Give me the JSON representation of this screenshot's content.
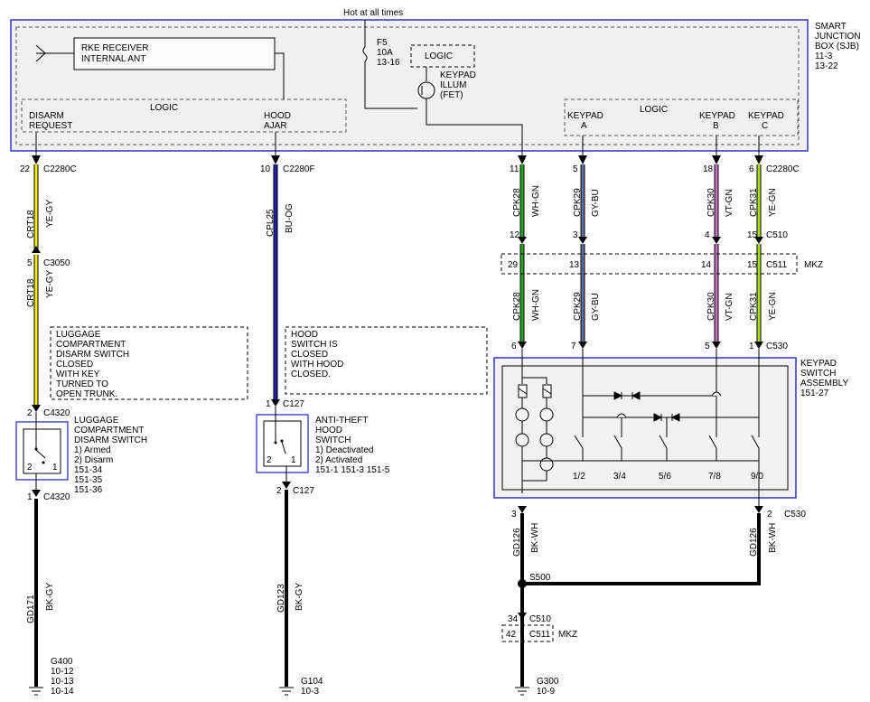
{
  "header": {
    "hot": "Hot at all times"
  },
  "sjb": {
    "name": [
      "SMART",
      "JUNCTION",
      "BOX (SJB)",
      "11-3",
      "13-22"
    ],
    "rke": [
      "RKE RECEIVER",
      "INTERNAL ANT"
    ],
    "fuse": [
      "F5",
      "10A",
      "13-16"
    ],
    "logic_small": "LOGIC",
    "keypad_illum": [
      "KEYPAD",
      "ILLUM",
      "(FET)"
    ],
    "logic_left": "LOGIC",
    "logic_right": "LOGIC",
    "disarm": [
      "DISARM",
      "REQUEST"
    ],
    "hood_ajar": [
      "HOOD",
      "AJAR"
    ],
    "keypad_a": [
      "KEYPAD",
      "A"
    ],
    "keypad_b": [
      "KEYPAD",
      "B"
    ],
    "keypad_c": [
      "KEYPAD",
      "C"
    ]
  },
  "left": {
    "pin1": "22",
    "conn1": "C2280C",
    "circuit1": "CRT18",
    "color1": "YE-GY",
    "pin2": "5",
    "conn2": "C3050",
    "circuit2": "CRT18",
    "color2": "YE-GY",
    "note": [
      "LUGGAGE",
      "COMPARTMENT",
      "DISARM SWITCH",
      "CLOSED",
      "WITH KEY",
      "TURNED TO",
      "OPEN TRUNK."
    ],
    "pin3": "2",
    "conn3": "C4320",
    "switch": [
      "LUGGAGE",
      "COMPARTMENT",
      "DISARM SWITCH",
      "1) Armed",
      "2) Disarm",
      "151-34",
      "151-35",
      "151-36"
    ],
    "sw_2": "2",
    "sw_1": "1",
    "pin4": "1",
    "conn4": "C4320",
    "circuit3": "GD171",
    "color3": "BK-GY",
    "ground": [
      "G400",
      "10-12",
      "10-13",
      "10-14"
    ]
  },
  "hood": {
    "pin1": "10",
    "conn1": "C2280F",
    "circuit1": "CPL25",
    "color1": "BU-OG",
    "note": [
      "HOOD",
      "SWITCH IS",
      "CLOSED",
      "WITH HOOD",
      "CLOSED."
    ],
    "pin2": "1",
    "conn2": "C127",
    "switch": [
      "ANTI-THEFT",
      "HOOD",
      "SWITCH",
      "1) Deactivated",
      "2) Activated",
      "151-1    151-3    151-5"
    ],
    "sw_2": "2",
    "sw_1": "1",
    "pin3": "2",
    "conn3": "C127",
    "circuit2": "GD123",
    "color2": "BK-GY",
    "ground": [
      "G104",
      "10-3"
    ]
  },
  "keypad": {
    "top_pins": [
      "11",
      "5",
      "18",
      "6"
    ],
    "top_conn": "C2280C",
    "circuits": [
      "CPK28",
      "CPK29",
      "CPK30",
      "CPK31"
    ],
    "colors": [
      "WH-GN",
      "GY-BU",
      "VT-GN",
      "YE-GN"
    ],
    "mid_pins": [
      "12",
      "3",
      "4",
      "15"
    ],
    "mid_conn": "C510",
    "mkz_pins": [
      "29",
      "13",
      "14",
      "15"
    ],
    "mkz_conn": "C511",
    "mkz": "MKZ",
    "low_pins": [
      "6",
      "7",
      "5",
      "1"
    ],
    "low_conn": "C530",
    "assembly": [
      "KEYPAD",
      "SWITCH",
      "ASSEMBLY",
      "151-27"
    ],
    "buttons": [
      "1/2",
      "3/4",
      "5/6",
      "7/8",
      "9/0"
    ],
    "out_pin_left": "3",
    "out_pin_right": "2",
    "out_conn": "C530",
    "gd_circuit": "GD126",
    "gd_color": "BK-WH",
    "splice": "S500",
    "c510_pin": "34",
    "c510": "C510",
    "c511_pin": "42",
    "c511": "C511",
    "mkz2": "MKZ",
    "ground": [
      "G300",
      "10-9"
    ]
  },
  "colors": {
    "frame": "#3333cc",
    "yellow": "#f0f000",
    "blue": "#2020b0",
    "green": "#22aa22",
    "violet": "#9040b0",
    "grayblue": "#6070a0"
  }
}
